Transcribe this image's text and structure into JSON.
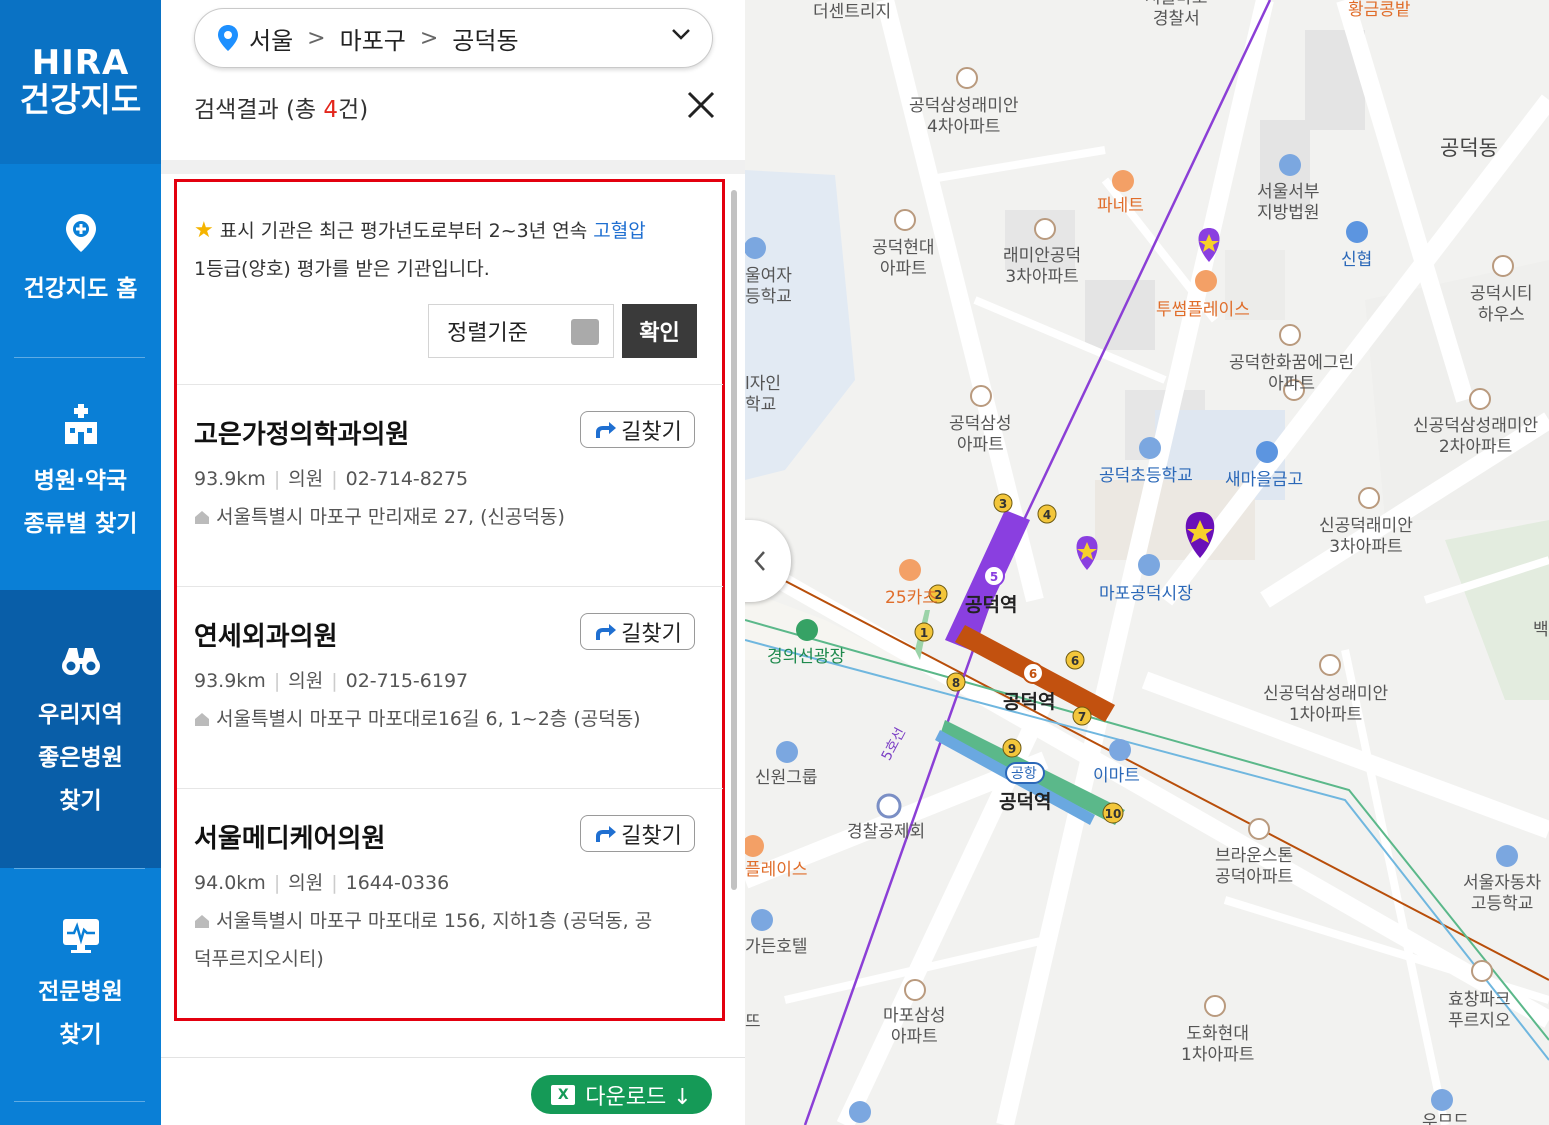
{
  "nav": {
    "logo_top": "HIRA",
    "logo_bottom": "건강지도",
    "items": [
      {
        "line1": "건강지도 홈",
        "line2": "",
        "line3": ""
      },
      {
        "line1": "병원·약국",
        "line2": "종류별 찾기",
        "line3": ""
      },
      {
        "line1": "우리지역",
        "line2": "좋은병원",
        "line3": "찾기"
      },
      {
        "line1": "전문병원",
        "line2": "찾기",
        "line3": ""
      }
    ]
  },
  "location": {
    "city": "서울",
    "district": "마포구",
    "dong": "공덕동",
    "sep": ">"
  },
  "result": {
    "prefix": "검색결과 (총 ",
    "count": "4",
    "suffix": "건)"
  },
  "notice": {
    "part1": "표시 기관은 최근 평가년도로부터 2~3년 연속 ",
    "highlight": "고혈압",
    "part2": "1등급(양호) 평가를 받은 기관입니다."
  },
  "sort": {
    "label": "정렬기준",
    "confirm": "확인"
  },
  "route_label": "길찾기",
  "hospitals": [
    {
      "name": "고은가정의학과의원",
      "distance": "93.9km",
      "type": "의원",
      "phone": "02-714-8275",
      "address": "서울특별시 마포구 만리재로 27, (신공덕동)"
    },
    {
      "name": "연세외과의원",
      "distance": "93.9km",
      "type": "의원",
      "phone": "02-715-6197",
      "address": "서울특별시 마포구 마포대로16길 6, 1~2층 (공덕동)"
    },
    {
      "name": "서울메디케어의원",
      "distance": "94.0km",
      "type": "의원",
      "phone": "1644-0336",
      "address": "서울특별시 마포구 마포대로 156, 지하1층 (공덕동, 공덕푸르지오시티)"
    }
  ],
  "download": {
    "icon_text": "X",
    "label": "다운로드 ↓"
  },
  "map": {
    "labels": {
      "thecentrej": "더센트리지",
      "police_top": "서울마포\n경찰서",
      "hwanggum": "황금콩밭",
      "raemian4": "공덕삼성래미안\n4차아파트",
      "gongdeokdong": "공덕동",
      "panete": "파네트",
      "court": "서울서부\n지방법원",
      "hyundai": "공덕현대\n아파트",
      "raemian3": "래미안공덕\n3차아파트",
      "sinhyeop": "신협",
      "citywise": "공덕시티\n하우스",
      "girls_school": "울여자\n등학교",
      "twosome": "투썸플레이스",
      "hanwha": "공덕한화꿈에그린\n아파트",
      "design_school": "l자인\n학교",
      "samsung_apt": "공덕삼성\n아파트",
      "elementary": "공덕초등학교",
      "saemaeul": "새마을금고",
      "raemian2": "신공덕삼성래미안\n2차아파트",
      "raemian3b": "신공덕래미안\n3차아파트",
      "park25": "25카츠",
      "station_top": "공덕역",
      "market": "마포공덕시장",
      "gyeongui": "경의선광장",
      "station_mid": "공덕역",
      "raemian1": "신공덕삼성래미안\n1차아파트",
      "line5": "5호선",
      "sinwon": "신원그룹",
      "airport": "공항",
      "emart": "이마트",
      "station_bot": "공덕역",
      "police_mutual": "경찰공제회",
      "brownstone": "브라운스톤\n공덕아파트",
      "auto_school": "서울자동차\n고등학교",
      "place": "플레이스",
      "garden": "가든호텔",
      "hyochang": "효창파크\n푸르지오",
      "mapo_samsung": "마포삼성\n아파트",
      "dohwa": "도화현대\n1차아파트",
      "ttu": "뜨",
      "baek": "백",
      "umd": "우므드"
    }
  }
}
